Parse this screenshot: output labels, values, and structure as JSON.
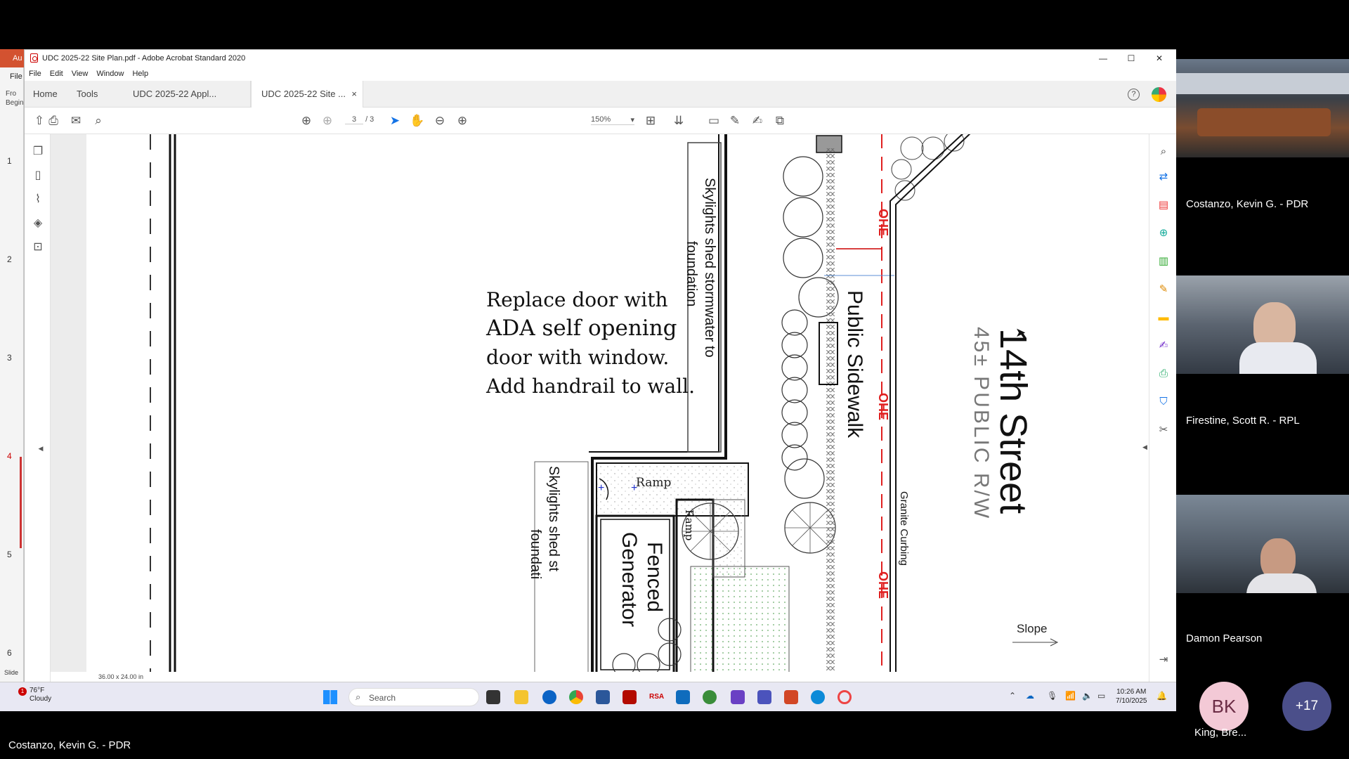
{
  "background_app": {
    "tab_label": "Au",
    "file_label": "File",
    "mini_labels": [
      "Fro",
      "Begin"
    ],
    "page_numbers": [
      "1",
      "2",
      "3",
      "4",
      "5",
      "6"
    ],
    "status": "Slide"
  },
  "window": {
    "title": "UDC 2025-22 Site Plan.pdf - Adobe Acrobat Standard 2020",
    "minimize": "—",
    "maximize": "☐",
    "close": "✕"
  },
  "menu": [
    "File",
    "Edit",
    "View",
    "Window",
    "Help"
  ],
  "tabs": {
    "home": "Home",
    "tools": "Tools",
    "doc1": "UDC 2025-22 Appl...",
    "doc2": "UDC 2025-22 Site ...",
    "doc2_close": "×",
    "help": "?"
  },
  "toolbar": {
    "page_current": "3",
    "page_total": "/ 3",
    "zoom": "150%"
  },
  "document": {
    "page_size": "36.00 x 24.00 in",
    "plan_labels": {
      "replace_door": [
        "Replace door with",
        "ADA self opening",
        "door with window.",
        "Add handrail to wall."
      ],
      "skylights_1": [
        "Skylights shed stormwater to",
        "foundation"
      ],
      "skylights_2": [
        "Skylights shed st",
        "foundati"
      ],
      "public_sidewalk": "Public Sidewalk",
      "street": "14th Street",
      "row": "45± PUBLIC R/W",
      "granite": "Granite Curbing",
      "ramp_h": "Ramp",
      "ramp_v": "Ramp",
      "generator": [
        "Fenced",
        "Generator"
      ],
      "ohe": "OHE",
      "slope": "Slope"
    }
  },
  "taskbar": {
    "temp": "76°F",
    "condition": "Cloudy",
    "badge": "1",
    "search_placeholder": "Search",
    "time": "10:26 AM",
    "date": "7/10/2025"
  },
  "meeting": {
    "participants": [
      {
        "name": "Costanzo, Kevin G. - PDR"
      },
      {
        "name": "Firestine, Scott R. - RPL"
      },
      {
        "name": "Damon Pearson"
      }
    ],
    "avatar_initials": "BK",
    "avatar_name": "King, Bre...",
    "more_count": "+17",
    "presenter_name": "Costanzo, Kevin G. - PDR",
    "avatar_color": "#f3c9d6",
    "more_color": "#4b4f8a"
  }
}
